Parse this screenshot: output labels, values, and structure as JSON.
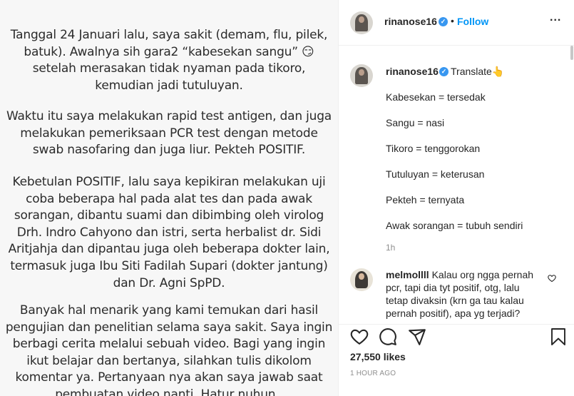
{
  "post_image": {
    "paragraphs": [
      [
        "Tanggal 24 Januari lalu, saya sakit (demam, flu, pilek,",
        "batuk). Awalnya sih gara2 “kabesekan sangu” 😏",
        "setelah merasakan tidak nyaman pada tikoro,",
        "kemudian jadi tutuluyan."
      ],
      [
        "Waktu itu saya melakukan rapid test antigen, dan juga",
        "melakukan pemeriksaan PCR test dengan metode",
        "swab nasofaring dan juga liur. Pekteh POSITIF."
      ],
      [
        "Kebetulan POSITIF, lalu saya kepikiran melakukan uji",
        "coba beberapa hal pada alat tes dan pada awak",
        "sorangan, dibantu suami dan dibimbing oleh virolog",
        "Drh. Indro Cahyono dan istri, serta herbalist dr. Sidi",
        "Aritjahja dan dipantau juga oleh beberapa dokter lain,",
        "termasuk juga Ibu Siti Fadilah Supari (dokter jantung)",
        "dan Dr. Agni SpPD."
      ],
      [
        "Banyak hal menarik yang kami temukan dari hasil",
        "pengujian dan penelitian selama saya sakit. Saya ingin",
        "berbagi cerita melalui sebuah video. Bagi yang ingin",
        "ikut belajar dan bertanya, silahkan tulis dikolom",
        "komentar ya. Pertanyaan nya akan saya jawab saat",
        "pembuatan video nanti. Hatur nuhun.."
      ]
    ]
  },
  "header": {
    "username": "rinanose16",
    "dot": "•",
    "follow_label": "Follow",
    "more_label": "..."
  },
  "caption": {
    "username": "rinanose16",
    "translate_label": "Translate👆",
    "lines": [
      "Kabesekan = tersedak",
      "Sangu = nasi",
      "Tikoro = tenggorokan",
      "Tutuluyan = keterusan",
      "Pekteh = ternyata",
      "Awak sorangan = tubuh sendiri"
    ],
    "time": "1h"
  },
  "comment": {
    "username": "melmollll",
    "text": "Kalau org ngga pernah pcr, tapi dia tyt positif, otg, lalu tetap divaksin (krn ga tau kalau pernah positif), apa yg terjadi?"
  },
  "actions": {
    "likes": "27,550 likes",
    "posted": "1 HOUR AGO"
  },
  "icons": {
    "like": "heart-icon",
    "comment": "comment-bubble-icon",
    "share": "share-plane-icon",
    "save": "bookmark-icon",
    "verified": "verified-badge-icon"
  },
  "colors": {
    "accent": "#0095f6",
    "verified": "#3897f0",
    "muted": "#8e8e8e",
    "text": "#262626"
  }
}
